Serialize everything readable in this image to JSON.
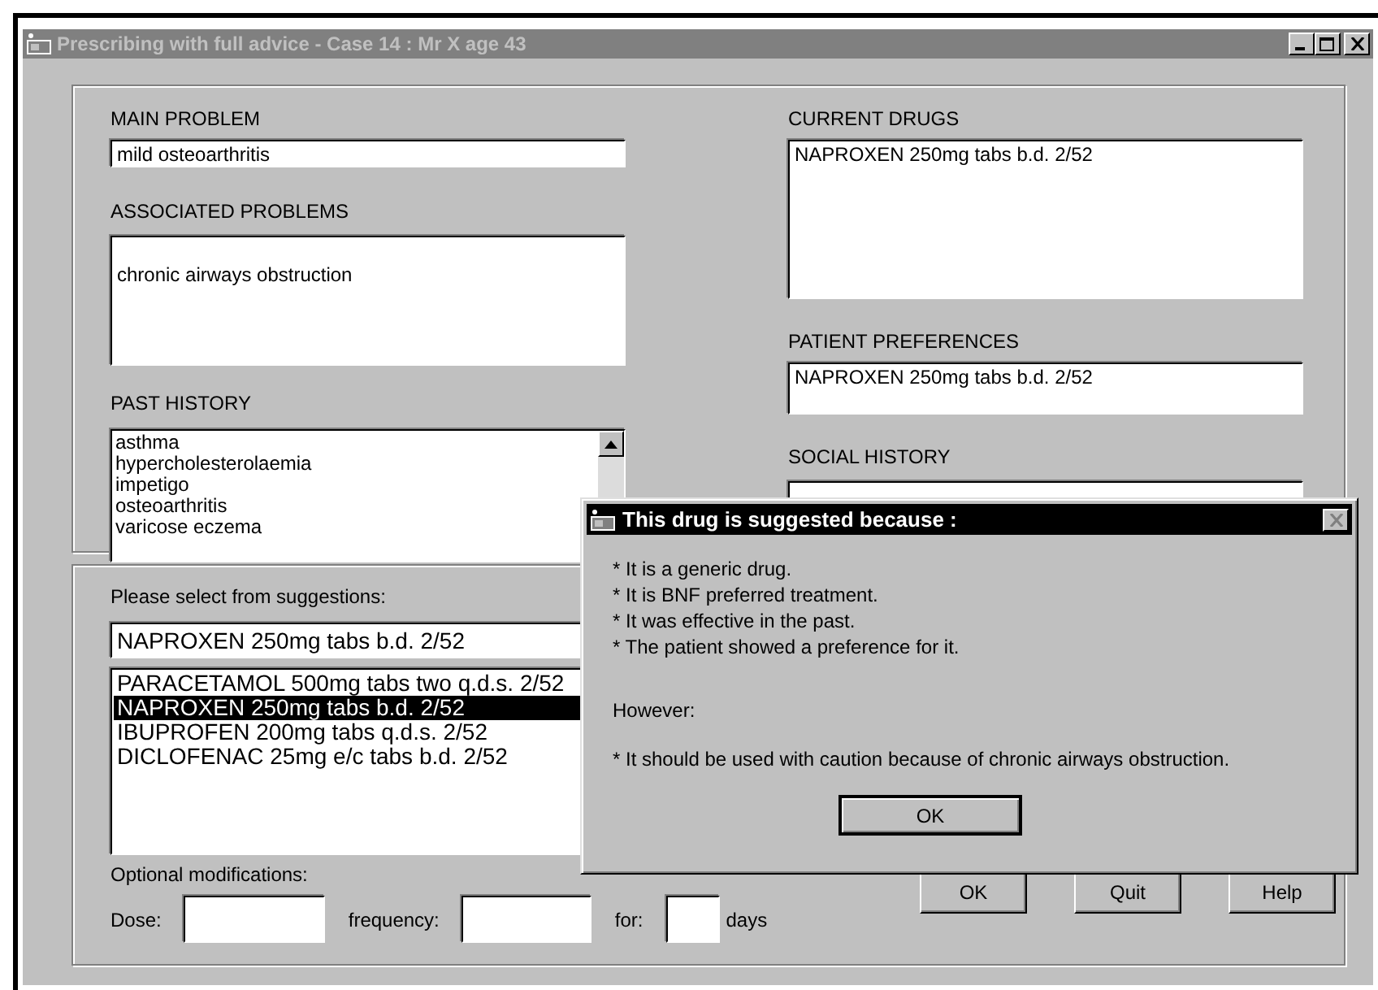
{
  "window": {
    "title": "Prescribing with full advice - Case 14 : Mr X age 43"
  },
  "main_problem": {
    "label": "MAIN PROBLEM",
    "value": "mild osteoarthritis"
  },
  "associated_problems": {
    "label": "ASSOCIATED PROBLEMS",
    "value": "chronic airways obstruction"
  },
  "past_history": {
    "label": "PAST HISTORY",
    "items": [
      "asthma",
      "hypercholesterolaemia",
      "impetigo",
      "osteoarthritis",
      "varicose eczema"
    ]
  },
  "current_drugs": {
    "label": "CURRENT DRUGS",
    "value": "NAPROXEN 250mg tabs b.d. 2/52"
  },
  "patient_preferences": {
    "label": "PATIENT PREFERENCES",
    "value": "NAPROXEN 250mg tabs b.d. 2/52"
  },
  "social_history": {
    "label": "SOCIAL HISTORY"
  },
  "suggestions": {
    "label": "Please select from suggestions:",
    "value": "NAPROXEN 250mg tabs b.d. 2/52",
    "items": [
      {
        "text": "PARACETAMOL 500mg tabs two q.d.s. 2/52",
        "selected": false
      },
      {
        "text": "NAPROXEN 250mg tabs b.d. 2/52",
        "selected": true
      },
      {
        "text": "IBUPROFEN 200mg tabs q.d.s. 2/52",
        "selected": false
      },
      {
        "text": "DICLOFENAC 25mg e/c tabs b.d. 2/52",
        "selected": false
      }
    ]
  },
  "modifications": {
    "label": "Optional modifications:",
    "fields": [
      {
        "label": "Dose:"
      },
      {
        "label": "frequency:"
      },
      {
        "label": "for:",
        "suffix": "days"
      }
    ]
  },
  "buttons": [
    "OK",
    "Quit",
    "Help"
  ],
  "dialog": {
    "title": "This drug is suggested because :",
    "reasons": [
      "* It is a generic drug.",
      "* It is BNF preferred treatment.",
      "* It was effective in the past.",
      "* The patient showed a preference for it."
    ],
    "however": "However:",
    "caution": "* It should be used with caution because of chronic airways obstruction.",
    "button": "OK"
  }
}
